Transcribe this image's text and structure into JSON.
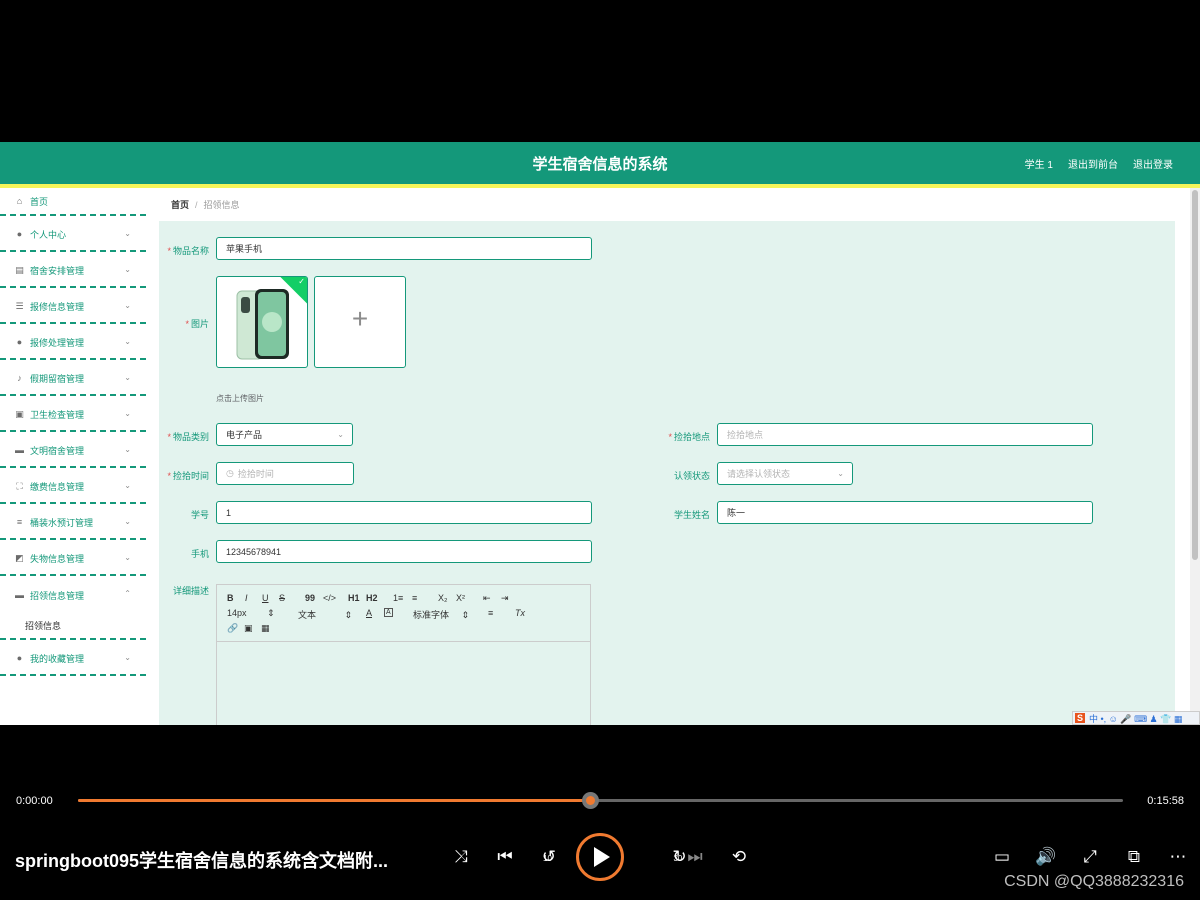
{
  "header": {
    "title": "学生宿舍信息的系统",
    "user": "学生 1",
    "to_front": "退出到前台",
    "logout": "退出登录"
  },
  "sidebar": {
    "items": [
      {
        "label": "首页",
        "icon": "home-icon"
      },
      {
        "label": "个人中心",
        "icon": "user-icon"
      },
      {
        "label": "宿舍安排管理",
        "icon": "clipboard-icon"
      },
      {
        "label": "报修信息管理",
        "icon": "sliders-icon"
      },
      {
        "label": "报修处理管理",
        "icon": "user-icon"
      },
      {
        "label": "假期留宿管理",
        "icon": "mic-icon"
      },
      {
        "label": "卫生检查管理",
        "icon": "briefcase-icon"
      },
      {
        "label": "文明宿舍管理",
        "icon": "monitor-icon"
      },
      {
        "label": "缴费信息管理",
        "icon": "fullscreen-icon"
      },
      {
        "label": "桶装水预订管理",
        "icon": "menu-icon"
      },
      {
        "label": "失物信息管理",
        "icon": "chart-icon"
      },
      {
        "label": "招领信息管理",
        "icon": "monitor-icon"
      },
      {
        "label": "我的收藏管理",
        "icon": "user-icon"
      }
    ],
    "sub_item": "招领信息"
  },
  "breadcrumb": {
    "home": "首页",
    "sep": "/",
    "current": "招领信息"
  },
  "form": {
    "name_label": "物品名称",
    "name_value": "苹果手机",
    "image_label": "图片",
    "upload_hint": "点击上传图片",
    "category_label": "物品类别",
    "category_value": "电子产品",
    "place_label": "捡拾地点",
    "place_placeholder": "捡拾地点",
    "time_label": "捡拾时间",
    "time_placeholder": "捡拾时间",
    "status_label": "认领状态",
    "status_placeholder": "请选择认领状态",
    "sid_label": "学号",
    "sid_value": "1",
    "sname_label": "学生姓名",
    "sname_value": "陈一",
    "phone_label": "手机",
    "phone_value": "12345678941",
    "desc_label": "详细描述",
    "required_mark": "*"
  },
  "editor": {
    "font_size": "14px",
    "text_type": "文本",
    "font_family": "标准字体",
    "buttons": {
      "bold": "B",
      "italic": "I",
      "underline": "U",
      "strike": "S",
      "quote": "99",
      "code": "</>",
      "h1": "H1",
      "h2": "H2",
      "ol": "1≡",
      "ul": "≡",
      "sub": "X₂",
      "sup": "X²",
      "indent_left": "⇤",
      "indent_right": "⇥",
      "color": "A",
      "bg": "A",
      "align": "≡",
      "clear": "Tx"
    }
  },
  "ime": {
    "brand": "S",
    "text": "中 •, ☺ 🎤 ⌨ ♟ 👕 ▦"
  },
  "player": {
    "current_time": "0:00:00",
    "total_time": "0:15:58",
    "progress_fraction": 0.49,
    "title": "springboot095学生宿舍信息的系统含文档附...",
    "watermark": "CSDN @QQ3888232316",
    "skip_back": "10",
    "skip_fwd": "30"
  },
  "colors": {
    "brand": "#14987a",
    "accent": "#f5f55a",
    "progress": "#f07a30"
  }
}
